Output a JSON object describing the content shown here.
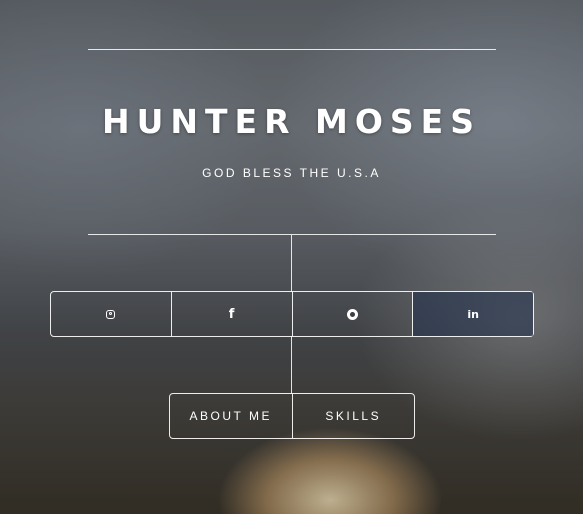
{
  "header": {
    "title": "HUNTER MOSES",
    "subtitle": "GOD BLESS THE U.S.A"
  },
  "social": [
    {
      "name": "instagram",
      "icon": "instagram-icon"
    },
    {
      "name": "facebook",
      "icon": "facebook-icon",
      "glyph": "f"
    },
    {
      "name": "github",
      "icon": "github-icon"
    },
    {
      "name": "linkedin",
      "icon": "linkedin-icon",
      "glyph": "in"
    }
  ],
  "nav": {
    "about_label": "ABOUT ME",
    "skills_label": "SKILLS"
  },
  "colors": {
    "text": "#ffffff",
    "border": "#ffffff"
  }
}
